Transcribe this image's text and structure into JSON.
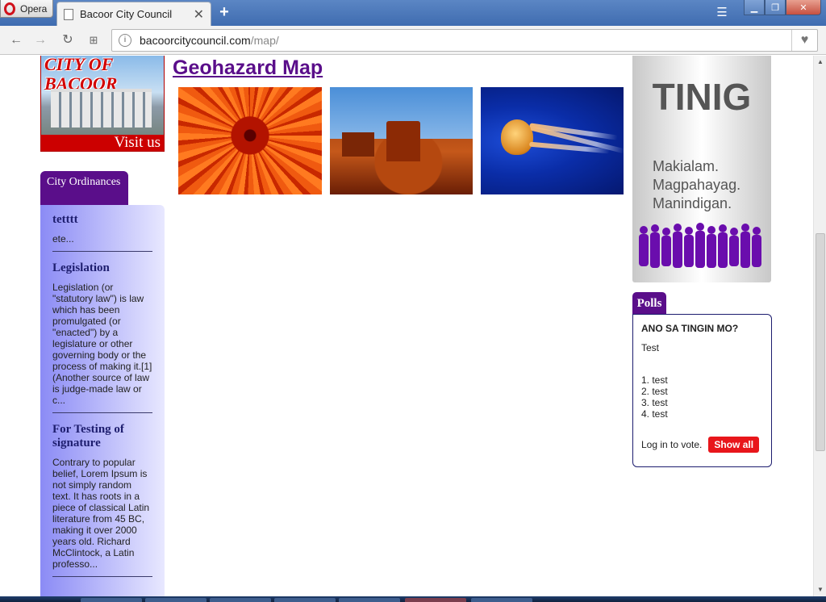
{
  "browser": {
    "menu_label": "Opera",
    "tab_title": "Bacoor City Council",
    "url_host": "bacoorcitycouncil.com",
    "url_path": "/map/"
  },
  "header_logo": {
    "title": "CITY OF BACOOR",
    "banner": "Visit us"
  },
  "ordinances": {
    "tab_label": "City Ordinances",
    "items": [
      {
        "title": "tetttt",
        "excerpt": "ete..."
      },
      {
        "title": "Legislation",
        "excerpt": "Legislation (or \"statutory law\") is law which has been promulgated (or \"enacted\") by a legislature or other governing body or the process of making it.[1] (Another source of law is judge-made law or c..."
      },
      {
        "title": "For Testing of signature",
        "excerpt": "Contrary to popular belief, Lorem Ipsum is not simply random text. It has roots in a piece of classical Latin literature from 45 BC, making it over 2000 years old. Richard McClintock, a Latin professo..."
      }
    ]
  },
  "main": {
    "title": "Geohazard Map",
    "images": [
      "flower",
      "desert",
      "jellyfish"
    ]
  },
  "tinig": {
    "title": "TINIG",
    "lines": [
      "Makialam.",
      "Magpahayag.",
      "Manindigan."
    ]
  },
  "polls": {
    "tab_label": "Polls",
    "question": "ANO SA TINGIN MO?",
    "description": "Test",
    "options": [
      "1. test",
      "2. test",
      "3. test",
      "4. test"
    ],
    "login_text": "Log in to vote.",
    "show_all_label": "Show all"
  },
  "colors": {
    "accent_purple": "#5a0e8a",
    "title_purple": "#5a0e8a",
    "button_red": "#e8161b"
  }
}
